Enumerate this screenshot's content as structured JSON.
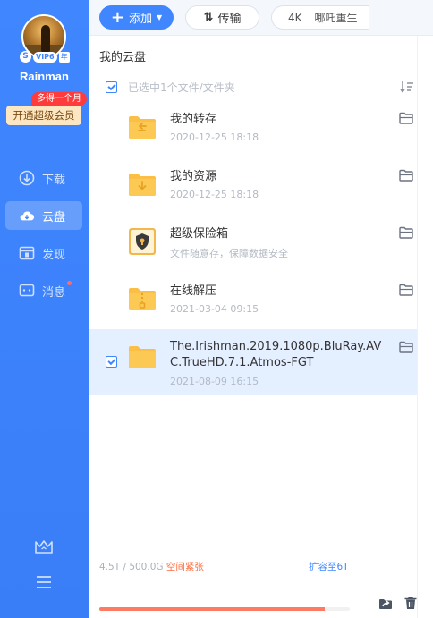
{
  "sidebar": {
    "username": "Rainman",
    "vip_s": "S",
    "vip_level": "VIP6",
    "vip_year": "年",
    "promo_tag": "多得一个月",
    "upgrade_label": "开通超级会员",
    "items": [
      {
        "label": "下载",
        "icon": "download-icon"
      },
      {
        "label": "云盘",
        "icon": "cloud-icon",
        "active": true
      },
      {
        "label": "发现",
        "icon": "discover-icon"
      },
      {
        "label": "消息",
        "icon": "message-icon",
        "unread_dot": true
      }
    ],
    "bottom_icons": [
      "crown-icon",
      "menu-icon"
    ]
  },
  "toolbar": {
    "add_label": "添加",
    "transfer_label": "传输",
    "search_hd": "4K",
    "search_text": "哪吒重生"
  },
  "main": {
    "title": "我的云盘",
    "selection_text": "已选中1个文件/文件夹",
    "files": [
      {
        "name": "我的转存",
        "sub": "2020-12-25 18:18",
        "icon": "transfer-folder-icon",
        "selected": false
      },
      {
        "name": "我的资源",
        "sub": "2020-12-25 18:18",
        "icon": "resource-folder-icon",
        "selected": false
      },
      {
        "name": "超级保险箱",
        "sub": "文件随意存，保障数据安全",
        "icon": "safe-box-icon",
        "selected": false
      },
      {
        "name": "在线解压",
        "sub": "2021-03-04 09:15",
        "icon": "unzip-folder-icon",
        "selected": false
      },
      {
        "name": "The.Irishman.2019.1080p.BluRay.AVC.TrueHD.7.1.Atmos-FGT",
        "sub": "2021-08-09 16:15",
        "icon": "folder-icon",
        "selected": true
      }
    ]
  },
  "footer": {
    "used": "4.5T / 500.0G",
    "warning": "空间紧张",
    "expand_label": "扩容至6T",
    "usage_fraction": 0.9
  },
  "colors": {
    "accent": "#3f86ff",
    "folder": "#fbbf45",
    "warning": "#ff6a3d"
  }
}
